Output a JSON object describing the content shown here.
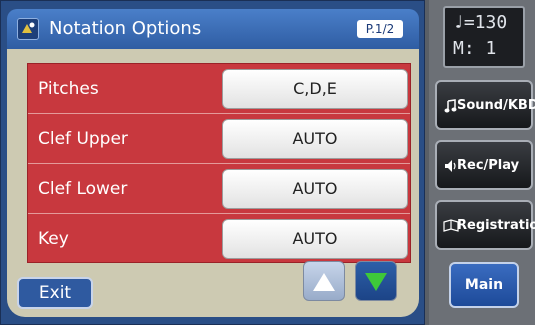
{
  "header": {
    "icon": "notation-icon",
    "title": "Notation Options",
    "page": "P.1/2"
  },
  "rows": [
    {
      "label": "Pitches",
      "value": "C,D,E"
    },
    {
      "label": "Clef Upper",
      "value": "AUTO"
    },
    {
      "label": "Clef Lower",
      "value": "AUTO"
    },
    {
      "label": "Key",
      "value": "AUTO"
    }
  ],
  "footer": {
    "exit_label": "Exit",
    "up_icon": "arrow-up-icon",
    "down_icon": "arrow-down-icon"
  },
  "side": {
    "tempo_line1": "♩=130",
    "tempo_line2": "M:  1",
    "buttons": [
      {
        "label": "Sound/KBD",
        "icon": "music-note-icon"
      },
      {
        "label": "Rec/Play",
        "icon": "speaker-icon"
      },
      {
        "label": "Registration",
        "icon": "book-icon"
      }
    ],
    "main_label": "Main"
  },
  "colors": {
    "title_blue": "#2f5da3",
    "row_red": "#c8383e",
    "content_bg": "#cdcab2",
    "down_arrow_green": "#3ec83a"
  }
}
